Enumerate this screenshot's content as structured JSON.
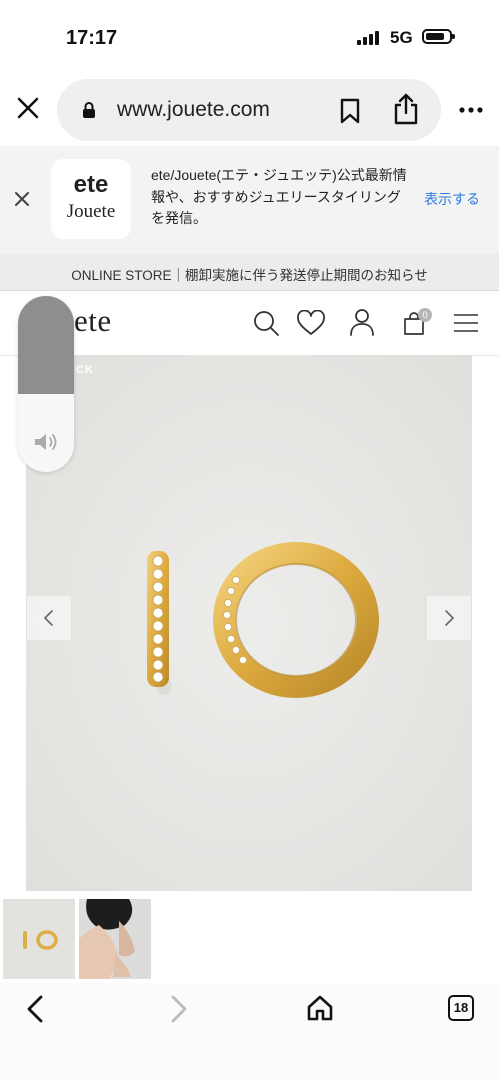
{
  "status_bar": {
    "time": "17:17",
    "network": "5G"
  },
  "browser": {
    "url": "www.jouete.com"
  },
  "app_banner": {
    "icon_line1": "ete",
    "icon_line2": "Jouete",
    "description": "ete/Jouete(エテ・ジュエッテ)公式最新情報や、おすすめジュエリースタイリングを発信。",
    "action_label": "表示する"
  },
  "notice": {
    "text": "ONLINE STORE｜棚卸実施に伴う発送停止期間のお知らせ"
  },
  "site_header": {
    "logo_visible": "uete",
    "cart_count": "0"
  },
  "product": {
    "image_label": "CK"
  },
  "tabs": {
    "count": "18"
  },
  "colors": {
    "accent_link": "#2a7ae2",
    "gold": "#e1b44a"
  }
}
